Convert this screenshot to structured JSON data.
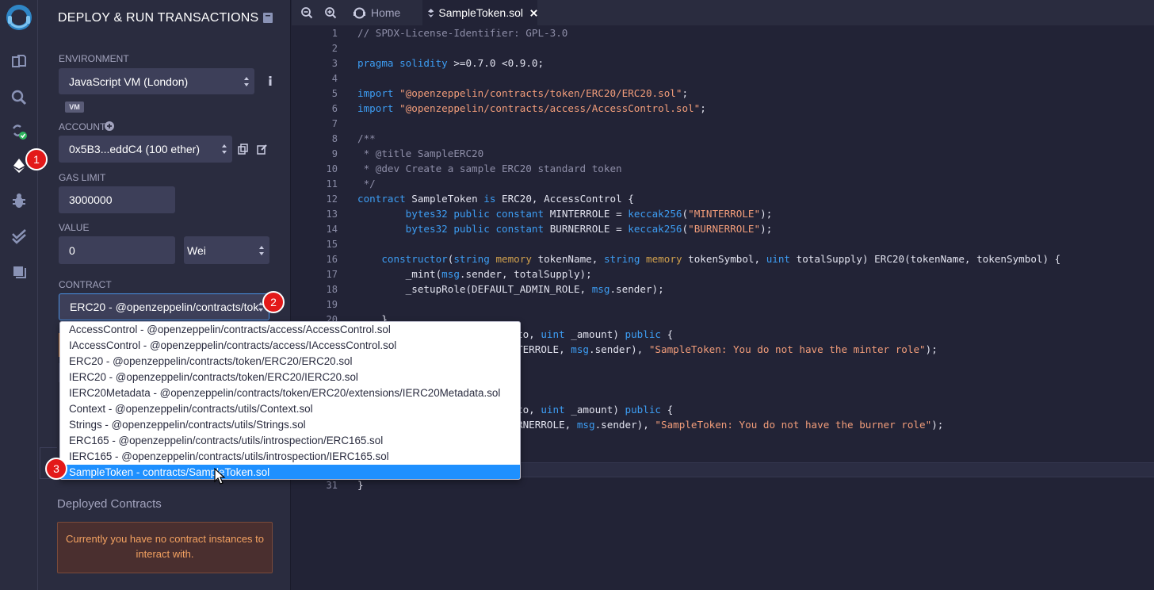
{
  "panel": {
    "title": "DEPLOY & RUN TRANSACTIONS",
    "environment": {
      "label": "ENVIRONMENT",
      "value": "JavaScript VM (London)",
      "badge": "VM"
    },
    "account": {
      "label": "ACCOUNT",
      "value": "0x5B3...eddC4 (100 ether)"
    },
    "gas_limit": {
      "label": "GAS LIMIT",
      "value": "3000000"
    },
    "value": {
      "label": "VALUE",
      "amount": "0",
      "unit": "Wei"
    },
    "contract": {
      "label": "CONTRACT",
      "value": "ERC20 - @openzeppelin/contracts/tok"
    },
    "deployed_label": "Deployed Contracts",
    "no_instances": "Currently you have no contract instances to interact with."
  },
  "dropdown": {
    "options": [
      "AccessControl - @openzeppelin/contracts/access/AccessControl.sol",
      "IAccessControl - @openzeppelin/contracts/access/IAccessControl.sol",
      "ERC20 - @openzeppelin/contracts/token/ERC20/ERC20.sol",
      "IERC20 - @openzeppelin/contracts/token/ERC20/IERC20.sol",
      "IERC20Metadata - @openzeppelin/contracts/token/ERC20/extensions/IERC20Metadata.sol",
      "Context - @openzeppelin/contracts/utils/Context.sol",
      "Strings - @openzeppelin/contracts/utils/Strings.sol",
      "ERC165 - @openzeppelin/contracts/utils/introspection/ERC165.sol",
      "IERC165 - @openzeppelin/contracts/utils/introspection/IERC165.sol",
      "SampleToken - contracts/SampleToken.sol"
    ],
    "selected_index": 9
  },
  "steps": [
    "1",
    "2",
    "3"
  ],
  "tabs": {
    "home": "Home",
    "file": "SampleToken.sol"
  },
  "editor": {
    "line_numbers": [
      "1",
      "2",
      "3",
      "4",
      "5",
      "6",
      "7",
      "8",
      "9",
      "10",
      "11",
      "12",
      "13",
      "14",
      "15",
      "16",
      "17",
      "18",
      "19",
      "20",
      "31"
    ],
    "lines": [
      "// SPDX-License-Identifier: GPL-3.0",
      "",
      "pragma solidity >=0.7.0 <0.9.0;",
      "",
      "import \"@openzeppelin/contracts/token/ERC20/ERC20.sol\";",
      "import \"@openzeppelin/contracts/access/AccessControl.sol\";",
      "",
      "/**",
      " * @title SampleERC20",
      " * @dev Create a sample ERC20 standard token",
      " */",
      "contract SampleToken is ERC20, AccessControl {",
      "        bytes32 public constant MINTERROLE = keccak256(\"MINTERROLE\");",
      "        bytes32 public constant BURNERROLE = keccak256(\"BURNERROLE\");",
      "",
      "    constructor(string memory tokenName, string memory tokenSymbol, uint totalSupply) ERC20(tokenName, tokenSymbol) {",
      "        _mint(msg.sender, totalSupply);",
      "        _setupRole(DEFAULT_ADMIN_ROLE, msg.sender);",
      "",
      "    }",
      "}"
    ],
    "visible_fragments": [
      "to, uint _amount) public {",
      "TERROLE, msg.sender), \"SampleToken: You do not have the minter role\");",
      ";",
      "to, uint _amount) public {",
      "RNERROLE, msg.sender), \"SampleToken: You do not have the burner role\");",
      ";"
    ]
  },
  "icons": [
    "remix-logo-icon",
    "file-explorer-icon",
    "search-icon",
    "compiler-icon",
    "deploy-run-icon",
    "debugger-icon",
    "testing-icon",
    "plugin-manager-icon"
  ]
}
